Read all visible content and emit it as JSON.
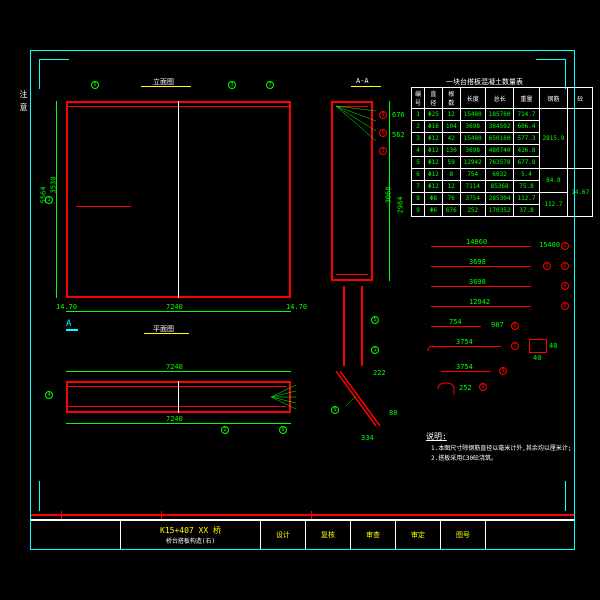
{
  "border_left_label": "注 意",
  "views": {
    "plan": "立面图",
    "elev": "平面图",
    "sec": "A-A",
    "amark": "A"
  },
  "dims": {
    "d7240_1": "7240",
    "d7240_2": "7240",
    "d7240_3": "7240",
    "d1470_1": "14.70",
    "d1470_2": "14.70",
    "d3530": "3530",
    "d5564": "5564",
    "d676": "676",
    "d562": "562",
    "d3068": "3068",
    "d2984": "2984",
    "d334": "334",
    "d222": "222",
    "d88": "88"
  },
  "title_block": {
    "proj": "K15+407  XX 桥",
    "sub": "桥台搭板构造(右)",
    "c1": "设计",
    "c2": "复核",
    "c3": "审查",
    "c4": "审定",
    "c5": "图号"
  },
  "table": {
    "title": "一块台搭板混凝土数量表",
    "headers": [
      "编号",
      "直径",
      "根数",
      "长度",
      "总长",
      "重量",
      "钢筋",
      "砼"
    ],
    "rows": [
      [
        "1",
        "Φ25",
        "12",
        "15480",
        "185760",
        "714.7",
        "",
        ""
      ],
      [
        "2",
        "Φ16",
        "104",
        "3698",
        "384592",
        "606.4",
        "",
        ""
      ],
      [
        "3",
        "Φ12",
        "42",
        "15480",
        "650160",
        "577.3",
        "2815.9",
        ""
      ],
      [
        "4",
        "Φ12",
        "130",
        "3698",
        "480740",
        "426.8",
        "",
        "14.67"
      ],
      [
        "5",
        "Φ12",
        "59",
        "12942",
        "763578",
        "677.8",
        "",
        ""
      ],
      [
        "6",
        "Φ12",
        "8",
        "754",
        "6032",
        "5.4",
        "84.8",
        ""
      ],
      [
        "7",
        "Φ12",
        "12",
        "7114",
        "85368",
        "75.8",
        "",
        ""
      ],
      [
        "8",
        "Φ8",
        "76",
        "3754",
        "285304",
        "112.7",
        "",
        ""
      ],
      [
        "9",
        "Φ6",
        "676",
        "252",
        "170352",
        "37.8",
        "",
        "112.7"
      ]
    ]
  },
  "rebar": {
    "r1": "14860",
    "r1e": "15480",
    "r2": "3698",
    "r4": "3698",
    "r5": "12942",
    "r6": "754",
    "r6e": "987",
    "r7": "3754",
    "r8": "3754",
    "r9": "252",
    "rw": "40",
    "rh": "40"
  },
  "notes": {
    "title": "说明:",
    "n1": "1.本图尺寸除钢筋直径以毫米计外,其余均以厘米计;",
    "n2": "2.搭板采用C30砼浇筑。"
  }
}
